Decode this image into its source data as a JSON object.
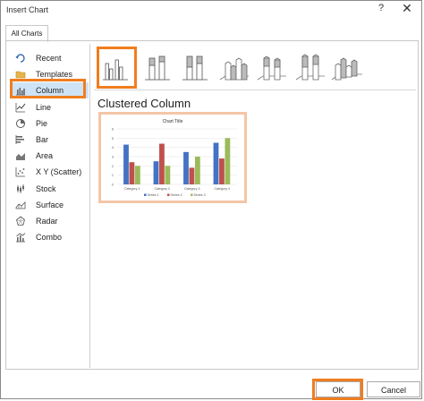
{
  "window": {
    "title": "Insert Chart",
    "help_label": "?",
    "close_label": "✕"
  },
  "tabs": [
    {
      "label": "All Charts"
    }
  ],
  "sidebar": {
    "items": [
      {
        "label": "Recent",
        "icon": "recent-icon"
      },
      {
        "label": "Templates",
        "icon": "folder-icon"
      },
      {
        "label": "Column",
        "icon": "column-chart-icon",
        "selected": true
      },
      {
        "label": "Line",
        "icon": "line-chart-icon"
      },
      {
        "label": "Pie",
        "icon": "pie-chart-icon"
      },
      {
        "label": "Bar",
        "icon": "bar-chart-icon"
      },
      {
        "label": "Area",
        "icon": "area-chart-icon"
      },
      {
        "label": "X Y (Scatter)",
        "icon": "scatter-chart-icon"
      },
      {
        "label": "Stock",
        "icon": "stock-chart-icon"
      },
      {
        "label": "Surface",
        "icon": "surface-chart-icon"
      },
      {
        "label": "Radar",
        "icon": "radar-chart-icon"
      },
      {
        "label": "Combo",
        "icon": "combo-chart-icon"
      }
    ]
  },
  "subtypes": {
    "selected_title": "Clustered Column",
    "items": [
      {
        "icon": "clustered-column-icon",
        "selected": true
      },
      {
        "icon": "stacked-column-icon"
      },
      {
        "icon": "100-stacked-column-icon"
      },
      {
        "icon": "3d-clustered-column-icon"
      },
      {
        "icon": "3d-stacked-column-icon"
      },
      {
        "icon": "3d-100-stacked-column-icon"
      },
      {
        "icon": "3d-column-icon"
      }
    ]
  },
  "buttons": {
    "ok": "OK",
    "cancel": "Cancel"
  },
  "colors": {
    "accent_highlight": "#f07d1f",
    "series1": "#4472c4",
    "series2": "#c0504d",
    "series3": "#9bbb59"
  },
  "chart_data": {
    "type": "bar",
    "title": "Chart Title",
    "categories": [
      "Category 1",
      "Category 2",
      "Category 3",
      "Category 4"
    ],
    "series": [
      {
        "name": "Series 1",
        "values": [
          4.3,
          2.5,
          3.5,
          4.5
        ]
      },
      {
        "name": "Series 2",
        "values": [
          2.4,
          4.4,
          1.8,
          2.8
        ]
      },
      {
        "name": "Series 3",
        "values": [
          2,
          2,
          3,
          5
        ]
      }
    ],
    "ylim": [
      0,
      6
    ],
    "yticks": [
      0,
      1,
      2,
      3,
      4,
      5,
      6
    ],
    "legend": "bottom",
    "grid": true
  }
}
